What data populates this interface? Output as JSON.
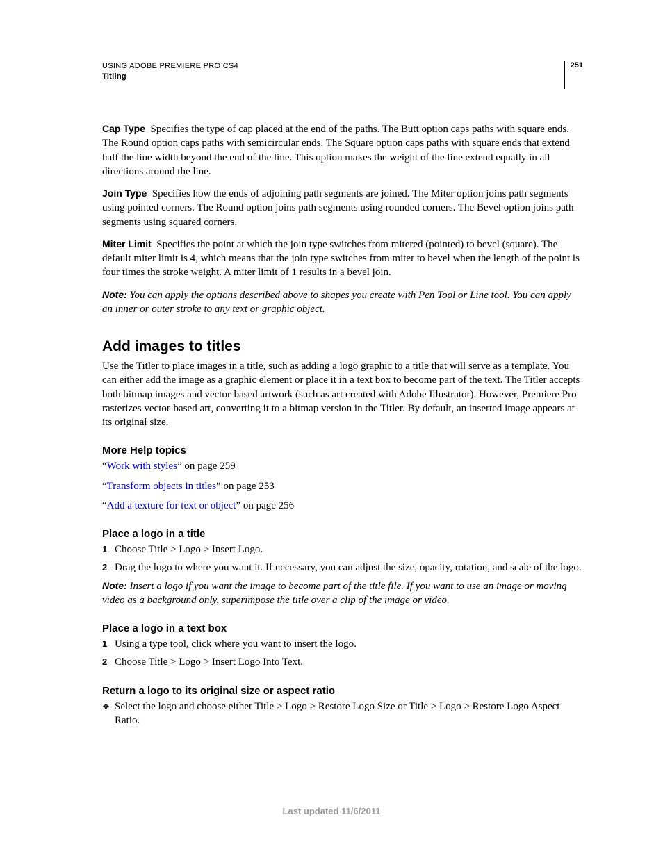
{
  "header": {
    "title": "USING ADOBE PREMIERE PRO CS4",
    "subtitle": "Titling",
    "page_number": "251"
  },
  "definitions": [
    {
      "term": "Cap Type",
      "text": "Specifies the type of cap placed at the end of the paths. The Butt option caps paths with square ends. The Round option caps paths with semicircular ends. The Square option caps paths with square ends that extend half the line width beyond the end of the line. This option makes the weight of the line extend equally in all directions around the line."
    },
    {
      "term": "Join Type",
      "text": "Specifies how the ends of adjoining path segments are joined. The Miter option joins path segments using pointed corners. The Round option joins path segments using rounded corners. The Bevel option joins path segments using squared corners."
    },
    {
      "term": "Miter Limit",
      "text": "Specifies the point at which the join type switches from mitered (pointed) to bevel (square). The default miter limit is 4, which means that the join type switches from miter to bevel when the length of the point is four times the stroke weight. A miter limit of 1 results in a bevel join."
    }
  ],
  "note1": {
    "label": "Note:",
    "text": "You can apply the options described above to shapes you create with Pen Tool or Line tool. You can apply an inner or outer stroke to any text or graphic object."
  },
  "section": {
    "title": "Add images to titles",
    "intro": "Use the Titler to place images in a title, such as adding a logo graphic to a title that will serve as a template. You can either add the image as a graphic element or place it in a text box to become part of the text. The Titler accepts both bitmap images and vector-based artwork (such as art created with Adobe Illustrator). However, Premiere Pro rasterizes vector-based art, converting it to a bitmap version in the Titler. By default, an inserted image appears at its original size."
  },
  "more_help": {
    "heading": "More Help topics",
    "items": [
      {
        "pre": "“",
        "link": "Work with styles",
        "post": "” on page 259"
      },
      {
        "pre": "“",
        "link": "Transform objects in titles",
        "post": "” on page 253"
      },
      {
        "pre": "“",
        "link": "Add a texture for text or object",
        "post": "” on page 256"
      }
    ]
  },
  "sub1": {
    "heading": "Place a logo in a title",
    "steps": [
      "Choose Title > Logo > Insert Logo.",
      "Drag the logo to where you want it. If necessary, you can adjust the size, opacity, rotation, and scale of the logo."
    ],
    "note": {
      "label": "Note:",
      "text": "Insert a logo if you want the image to become part of the title file. If you want to use an image or moving video as a background only, superimpose the title over a clip of the image or video."
    }
  },
  "sub2": {
    "heading": "Place a logo in a text box",
    "steps": [
      "Using a type tool, click where you want to insert the logo.",
      "Choose Title > Logo > Insert Logo Into Text."
    ]
  },
  "sub3": {
    "heading": "Return a logo to its original size or aspect ratio",
    "bullet": "Select the logo and choose either Title > Logo > Restore Logo Size or Title > Logo > Restore Logo Aspect Ratio."
  },
  "footer": "Last updated 11/6/2011"
}
